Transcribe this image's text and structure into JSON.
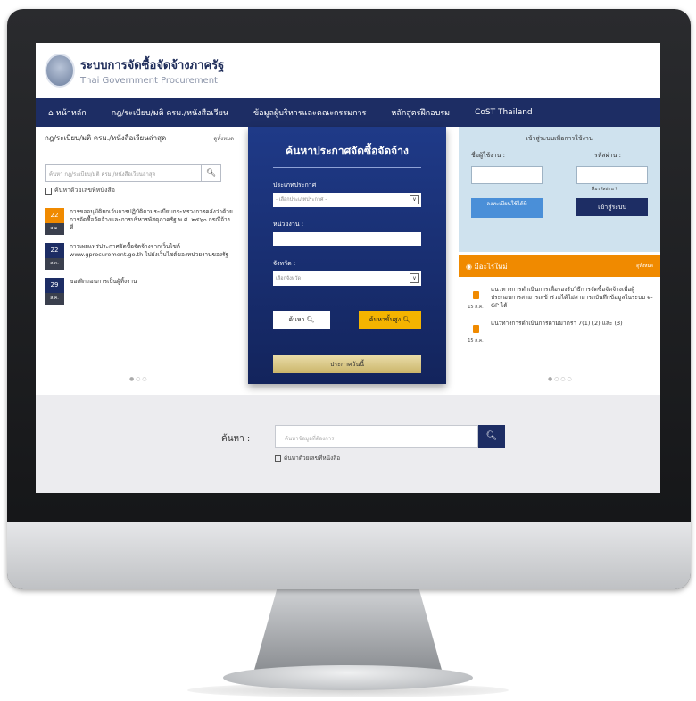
{
  "site": {
    "name_th": "ระบบการจัดซื้อจัดจ้างภาครัฐ",
    "name_en": "Thai Government Procurement"
  },
  "nav": {
    "home": "หน้าหลัก",
    "items": [
      "กฎ/ระเบียบ/มติ ครม./หนังสือเวียน",
      "ข้อมูลผู้บริหารและคณะกรรมการ",
      "หลักสูตรฝึกอบรม",
      "CoST Thailand"
    ]
  },
  "left": {
    "title": "กฎ/ระเบียบ/มติ ครม./หนังสือเวียนล่าสุด",
    "more": "ดูทั้งหมด",
    "search_placeholder": "ค้นหา กฎ/ระเบียบ/มติ ครม./หนังสือเวียนล่าสุด",
    "checkbox": "ค้นหาด้วยเลขที่หนังสือ",
    "news": [
      {
        "day": "22",
        "month": "ส.ค.",
        "text": "การขออนุมัติยกเว้นการปฏิบัติตามระเบียบกระทรวงการคลังว่าด้วยการจัดซื้อจัดจ้างและการบริหารพัสดุภาครัฐ พ.ศ. ๒๕๖๐ กรณีจ้างที่",
        "color": "#f08a00"
      },
      {
        "day": "22",
        "month": "ส.ค.",
        "text": "การเผยแพร่ประกาศจัดซื้อจัดจ้างจากเว็บไซต์ www.gprocurement.go.th ไปยังเว็บไซต์ของหน่วยงานของรัฐ",
        "color": "#1d2d64"
      },
      {
        "day": "29",
        "month": "ส.ค.",
        "text": "ขอเพิกถอนการเป็นผู้ทิ้งงาน",
        "color": "#1d2d64"
      }
    ],
    "dots": "● ○ ○"
  },
  "center": {
    "title": "ค้นหาประกาศจัดซื้อจัดจ้าง",
    "type_label": "ประเภทประกาศ",
    "type_value": "- เลือกประเภทประกาศ -",
    "agency_label": "หน่วยงาน :",
    "province_label": "จังหวัด :",
    "province_value": "เลือกจังหวัด",
    "search_btn": "ค้นหา",
    "adv_btn": "ค้นหาขั้นสูง",
    "announce_btn": "ประกาศวันนี้"
  },
  "login": {
    "title": "เข้าสู่ระบบเพื่อการใช้งาน",
    "user_label": "ชื่อผู้ใช้งาน :",
    "pass_label": "รหัสผ่าน :",
    "forgot": "ลืมรหัสผ่าน ?",
    "register": "ลงทะเบียนใช้ได้ที่",
    "login_btn": "เข้าสู่ระบบ"
  },
  "whatsnew": {
    "title": "มีอะไรใหม่",
    "more": "ดูทั้งหมด",
    "items": [
      {
        "date": "15 ส.ค.",
        "text": "แนวทางการดำเนินการเพื่อรองรับวิธีการจัดซื้อจัดจ้างเพื่อผู้ประกอบการสามารถเข้าร่วมได้ไม่สามารถบันทึกข้อมูลในระบบ e-GP ได้"
      },
      {
        "date": "15 ส.ค.",
        "text": "แนวทางการดำเนินการตามมาตรา 7(1) (2) และ (3)"
      }
    ],
    "dots": "● ○ ○ ○"
  },
  "bottom": {
    "label": "ค้นหา :",
    "placeholder": "ค้นหาข้อมูลที่ต้องการ",
    "checkbox": "ค้นหาด้วยเลขที่หนังสือ"
  },
  "icons": {
    "home": "home-icon",
    "search": "search-icon",
    "rss": "rss-icon",
    "document": "document-icon"
  }
}
